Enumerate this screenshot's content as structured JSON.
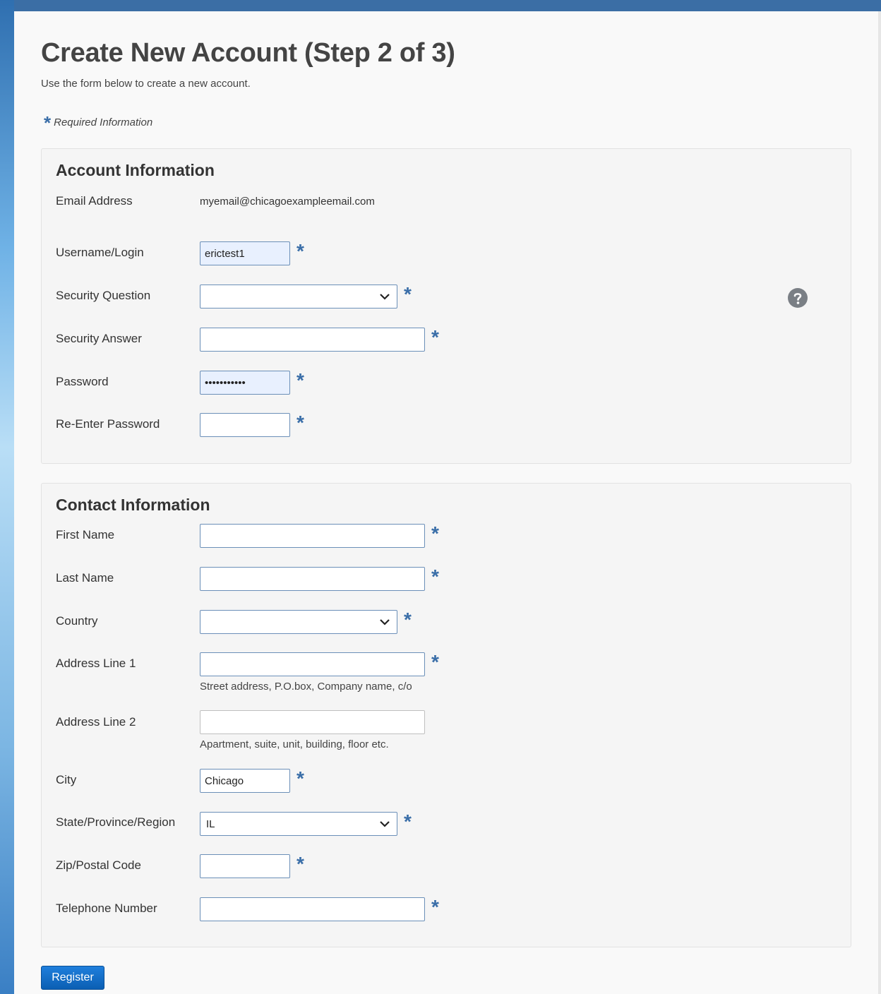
{
  "header": {
    "title": "Create New Account (Step 2 of 3)",
    "subtitle": "Use the form below to create a new account.",
    "required_star": "*",
    "required_note": "Required Information"
  },
  "account": {
    "section_title": "Account Information",
    "email_label": "Email Address",
    "email_value": "myemail@chicagoexampleemail.com",
    "username_label": "Username/Login",
    "username_value": "erictest1",
    "security_question_label": "Security Question",
    "security_question_value": "",
    "security_answer_label": "Security Answer",
    "security_answer_value": "",
    "password_label": "Password",
    "password_value": "•••••••••••",
    "reenter_password_label": "Re-Enter Password",
    "reenter_password_value": ""
  },
  "contact": {
    "section_title": "Contact Information",
    "first_name_label": "First Name",
    "first_name_value": "",
    "last_name_label": "Last Name",
    "last_name_value": "",
    "country_label": "Country",
    "country_value": "",
    "address1_label": "Address Line 1",
    "address1_value": "",
    "address1_hint": "Street address, P.O.box, Company name, c/o",
    "address2_label": "Address Line 2",
    "address2_value": "",
    "address2_hint": "Apartment, suite, unit, building, floor etc.",
    "city_label": "City",
    "city_value": "Chicago",
    "state_label": "State/Province/Region",
    "state_value": "IL",
    "zip_label": "Zip/Postal Code",
    "zip_value": "",
    "phone_label": "Telephone Number",
    "phone_value": ""
  },
  "actions": {
    "register_label": "Register"
  },
  "icons": {
    "help": "question-circle-icon",
    "select_arrow": "chevron-down-icon",
    "required": "asterisk-icon"
  },
  "colors": {
    "top_bar": "#3b6ea5",
    "required_star": "#3a6ea8",
    "register_button": "#0b5fb3",
    "autofill_background": "#e8f0fe",
    "panel_background": "#f5f5f5"
  }
}
